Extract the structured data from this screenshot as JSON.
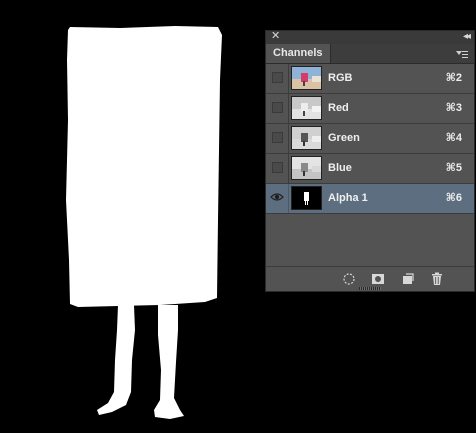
{
  "panel": {
    "close_glyph": "✕",
    "collapse_glyph": "◂◂",
    "tab_label": "Channels",
    "menu_icon": "panel-menu-icon"
  },
  "channels": [
    {
      "name": "RGB",
      "shortcut": "⌘2",
      "visible": false,
      "selected": false,
      "thumb": "color"
    },
    {
      "name": "Red",
      "shortcut": "⌘3",
      "visible": false,
      "selected": false,
      "thumb": "gray"
    },
    {
      "name": "Green",
      "shortcut": "⌘4",
      "visible": false,
      "selected": false,
      "thumb": "gray"
    },
    {
      "name": "Blue",
      "shortcut": "⌘5",
      "visible": false,
      "selected": false,
      "thumb": "gray"
    },
    {
      "name": "Alpha 1",
      "shortcut": "⌘6",
      "visible": true,
      "selected": true,
      "thumb": "mask"
    }
  ],
  "bottom_buttons": [
    "load-selection-icon",
    "save-selection-icon",
    "new-channel-icon",
    "trash-icon"
  ],
  "colors": {
    "canvas_bg": "#000000",
    "mask_fg": "#ffffff",
    "panel_bg": "#535353",
    "selected_row": "#5d6e80"
  }
}
